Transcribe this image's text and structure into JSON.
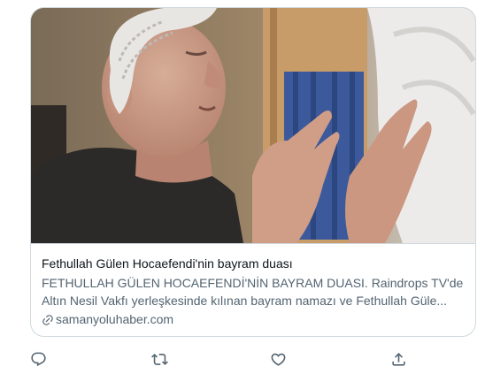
{
  "link_card": {
    "image_alt": "Fethullah Gülen praying with raised hands",
    "title": "Fethullah Gülen Hocaefendi'nin bayram duası",
    "description": "FETHULLAH GÜLEN HOCAEFENDİ'NİN BAYRAM DUASI. Raindrops TV'de Altın Nesil Vakfı yerleşkesinde kılınan bayram namazı ve Fethullah Güle...",
    "domain": "samanyoluhaber.com",
    "link_icon": "link-icon"
  },
  "actions": [
    {
      "name": "reply",
      "icon": "reply-icon"
    },
    {
      "name": "retweet",
      "icon": "retweet-icon"
    },
    {
      "name": "like",
      "icon": "heart-icon"
    },
    {
      "name": "share",
      "icon": "share-icon"
    }
  ],
  "colors": {
    "border": "#cfd9de",
    "text_primary": "#0f1419",
    "text_secondary": "#536471"
  }
}
